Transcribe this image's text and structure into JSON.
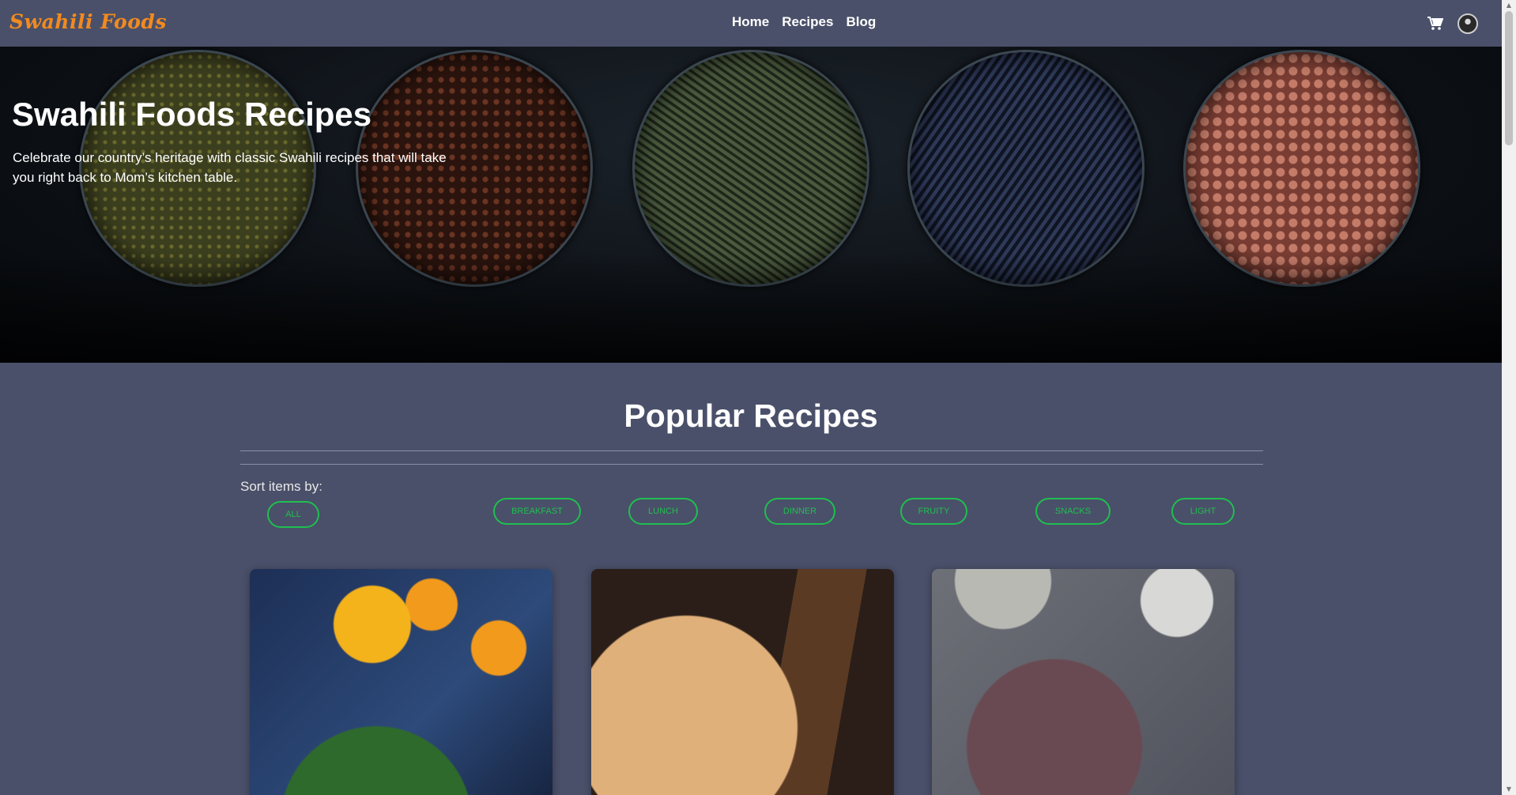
{
  "navbar": {
    "brand": "Swahili Foods",
    "links": [
      "Home",
      "Recipes",
      "Blog"
    ],
    "cart_icon": "shopping-cart-icon",
    "avatar_icon": "user-avatar"
  },
  "hero": {
    "title": "Swahili Foods Recipes",
    "text": "Celebrate our country’s heritage with classic Swahili recipes that will take you right back to Mom’s kitchen table."
  },
  "popular": {
    "title": "Popular Recipes",
    "sort_label": "Sort items by:",
    "filters": [
      "ALL",
      "BREAKFAST",
      "LUNCH",
      "DINNER",
      "FRUITY",
      "SNACKS",
      "LIGHT"
    ]
  },
  "colors": {
    "background": "#4a5069",
    "brand": "#f28a1f",
    "filter_accent": "#1fbf4f"
  }
}
